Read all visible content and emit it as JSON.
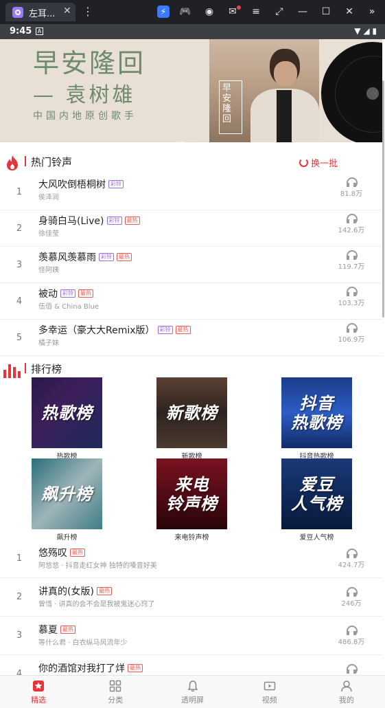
{
  "emulator": {
    "tab_title": "左耳...",
    "tab_close": "✕",
    "menu_glyph": "⋮"
  },
  "status": {
    "time": "9:45",
    "notif": "A"
  },
  "banner": {
    "title": "早安隆回",
    "subtitle": "— 袁树雄",
    "desc": "中国内地原创歌手",
    "album_text": "早安隆回"
  },
  "hot": {
    "title": "热门铃声",
    "refresh_label": "换一批",
    "songs": [
      {
        "rank": "1",
        "name": "大风吹倒梧桐树",
        "artist": "侯泽润",
        "tags": [
          "彩铃"
        ],
        "plays": "81.8万"
      },
      {
        "rank": "2",
        "name": "身骑白马(Live)",
        "artist": "徐佳莹",
        "tags": [
          "彩铃",
          "最热"
        ],
        "plays": "142.6万"
      },
      {
        "rank": "3",
        "name": "羡慕风羡慕雨",
        "artist": "怪阿姨",
        "tags": [
          "彩铃",
          "最热"
        ],
        "plays": "119.7万"
      },
      {
        "rank": "4",
        "name": "被动",
        "artist": "伍佰 & China Blue",
        "tags": [
          "彩铃",
          "最热"
        ],
        "plays": "103.3万"
      },
      {
        "rank": "5",
        "name": "多幸运（豪大大Remix版）",
        "artist": "橘子妹",
        "tags": [
          "彩铃",
          "最热"
        ],
        "plays": "106.9万"
      }
    ]
  },
  "ranking": {
    "title": "排行榜",
    "charts": [
      {
        "label": "热歌榜",
        "cover_text": "热歌榜"
      },
      {
        "label": "新歌榜",
        "cover_text": "新歌榜"
      },
      {
        "label": "抖音热歌榜",
        "cover_text": "抖音\n热歌榜"
      },
      {
        "label": "飙升榜",
        "cover_text": "飙升榜"
      },
      {
        "label": "来电铃声榜",
        "cover_text": "来电\n铃声榜"
      },
      {
        "label": "爱豆人气榜",
        "cover_text": "爱豆\n人气榜"
      }
    ],
    "songs": [
      {
        "rank": "1",
        "name": "悠殇叹",
        "artist": "阿悠悠 · 抖音走红女神 独特的嗓音好美",
        "tags": [
          "最热"
        ],
        "plays": "424.7万"
      },
      {
        "rank": "2",
        "name": "讲真的(女版)",
        "artist": "曾惜 · 讲真的会不会是我被鬼迷心窍了",
        "tags": [
          "最热"
        ],
        "plays": "246万"
      },
      {
        "rank": "3",
        "name": "慕夏",
        "artist": "等什么君 · 白衣纵马风流年少",
        "tags": [
          "最热"
        ],
        "plays": "486.8万"
      },
      {
        "rank": "4",
        "name": "你的酒馆对我打了烊",
        "artist": "",
        "tags": [
          "最热"
        ],
        "plays": ""
      }
    ]
  },
  "nav": {
    "items": [
      {
        "label": "精选",
        "icon": "star-icon",
        "active": true
      },
      {
        "label": "分类",
        "icon": "grid-icon",
        "active": false
      },
      {
        "label": "透明屏",
        "icon": "bell-icon",
        "active": false
      },
      {
        "label": "视频",
        "icon": "video-icon",
        "active": false
      },
      {
        "label": "我的",
        "icon": "user-icon",
        "active": false
      }
    ]
  },
  "colors": {
    "accent": "#e8333a",
    "banner_bg": "#e8e0d5",
    "banner_text": "#6e8a6f",
    "tag_cl": "#9b6cdf",
    "tag_hot": "#e85a4f"
  }
}
